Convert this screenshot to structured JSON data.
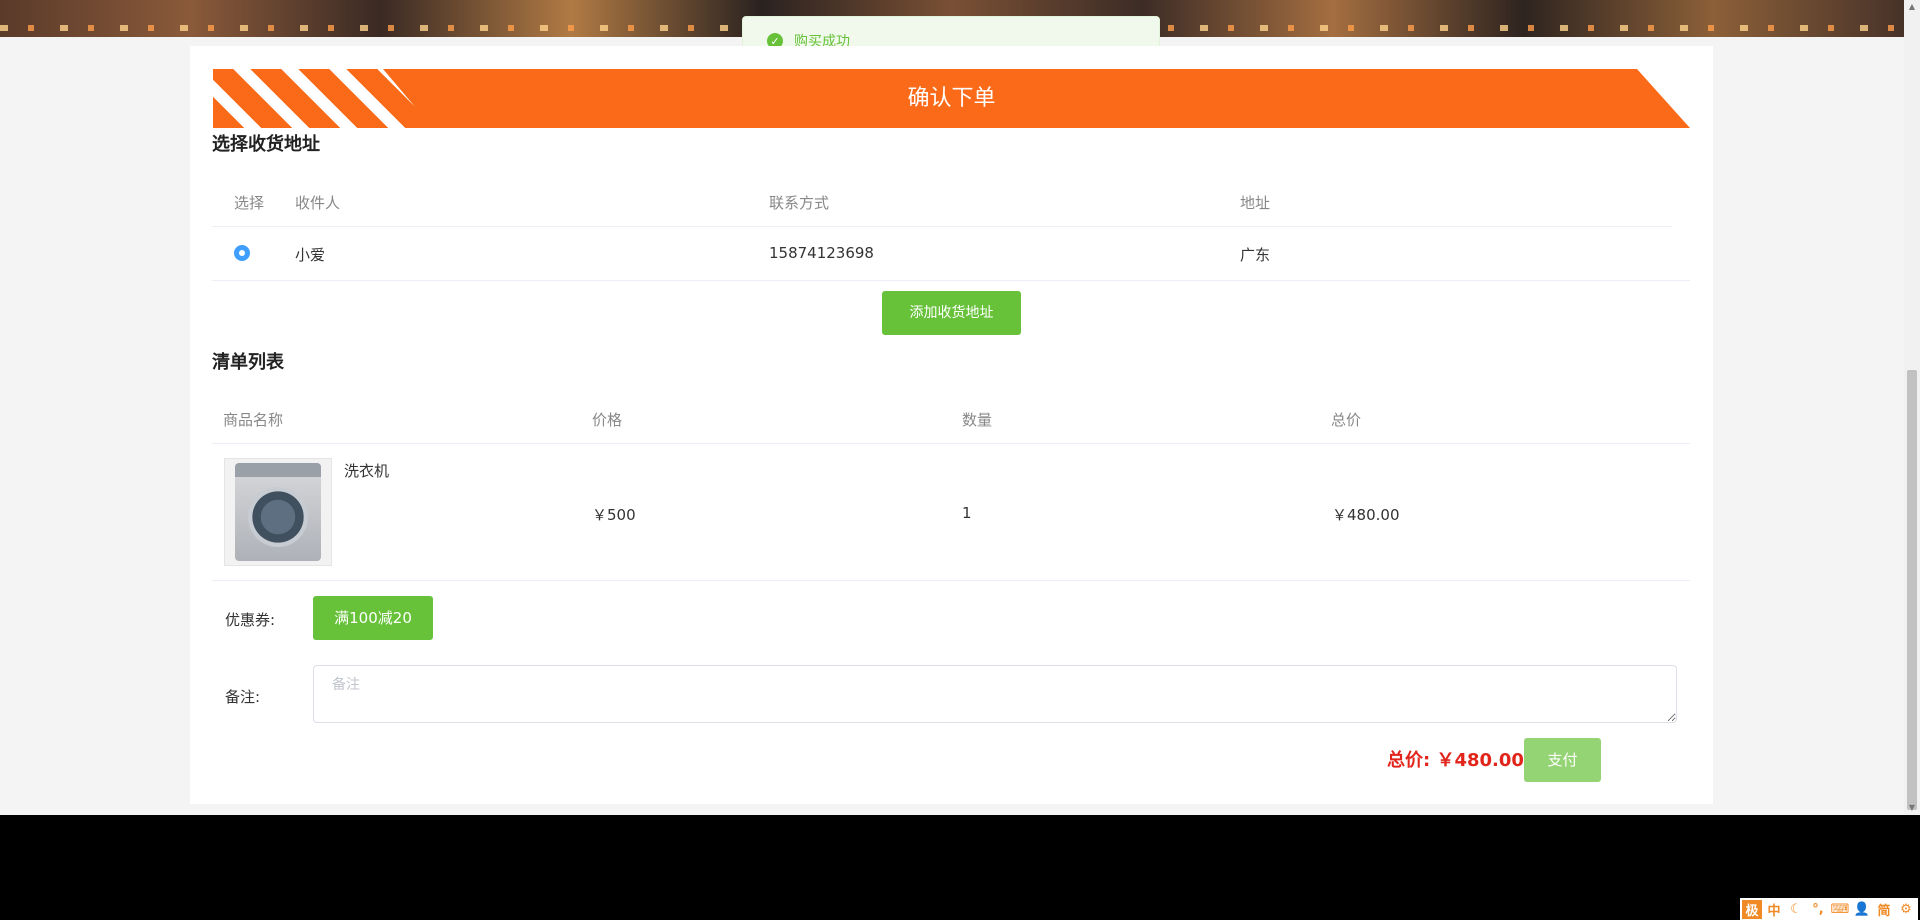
{
  "toast": {
    "message": "购买成功"
  },
  "order": {
    "title": "确认下单",
    "address_section": {
      "title": "选择收货地址",
      "headers": {
        "select": "选择",
        "recipient": "收件人",
        "contact": "联系方式",
        "address": "地址"
      },
      "rows": [
        {
          "recipient": "小爱",
          "contact": "15874123698",
          "address": "广东",
          "selected": true
        }
      ],
      "add_button": "添加收货地址"
    },
    "list_section": {
      "title": "清单列表",
      "headers": {
        "name": "商品名称",
        "price": "价格",
        "quantity": "数量",
        "total": "总价"
      },
      "items": [
        {
          "name": "洗衣机",
          "price": "￥500",
          "quantity": "1",
          "total": "￥480.00"
        }
      ]
    },
    "coupon": {
      "label": "优惠券:",
      "value": "满100减20"
    },
    "note": {
      "label": "备注:",
      "placeholder": "备注",
      "value": ""
    },
    "summary": {
      "total_label": "总价:",
      "total_value": "￥480.00",
      "pay_button": "支付"
    }
  },
  "ime_toolbar": [
    "极",
    "中",
    "☾",
    "°,",
    "⌨",
    "👤",
    "简",
    "⚙"
  ],
  "colors": {
    "accent_orange": "#fb6a18",
    "success_green": "#67c23a",
    "price_red": "#e1251b",
    "radio_blue": "#409eff"
  }
}
